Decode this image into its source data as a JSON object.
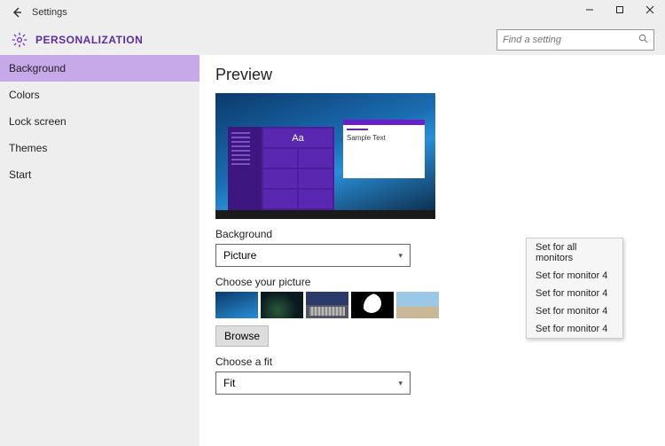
{
  "window": {
    "title": "Settings",
    "heading": "PERSONALIZATION"
  },
  "search": {
    "placeholder": "Find a setting"
  },
  "sidebar": {
    "items": [
      {
        "label": "Background",
        "active": true
      },
      {
        "label": "Colors"
      },
      {
        "label": "Lock screen"
      },
      {
        "label": "Themes"
      },
      {
        "label": "Start"
      }
    ]
  },
  "content": {
    "preview_title": "Preview",
    "sample_text": "Sample Text",
    "tile_text": "Aa",
    "background_label": "Background",
    "background_value": "Picture",
    "choose_picture_label": "Choose your picture",
    "browse_label": "Browse",
    "choose_fit_label": "Choose a fit",
    "fit_value": "Fit"
  },
  "context_menu": {
    "items": [
      "Set for all monitors",
      "Set for monitor 4",
      "Set for monitor 4",
      "Set for monitor 4",
      "Set for monitor 4"
    ]
  }
}
